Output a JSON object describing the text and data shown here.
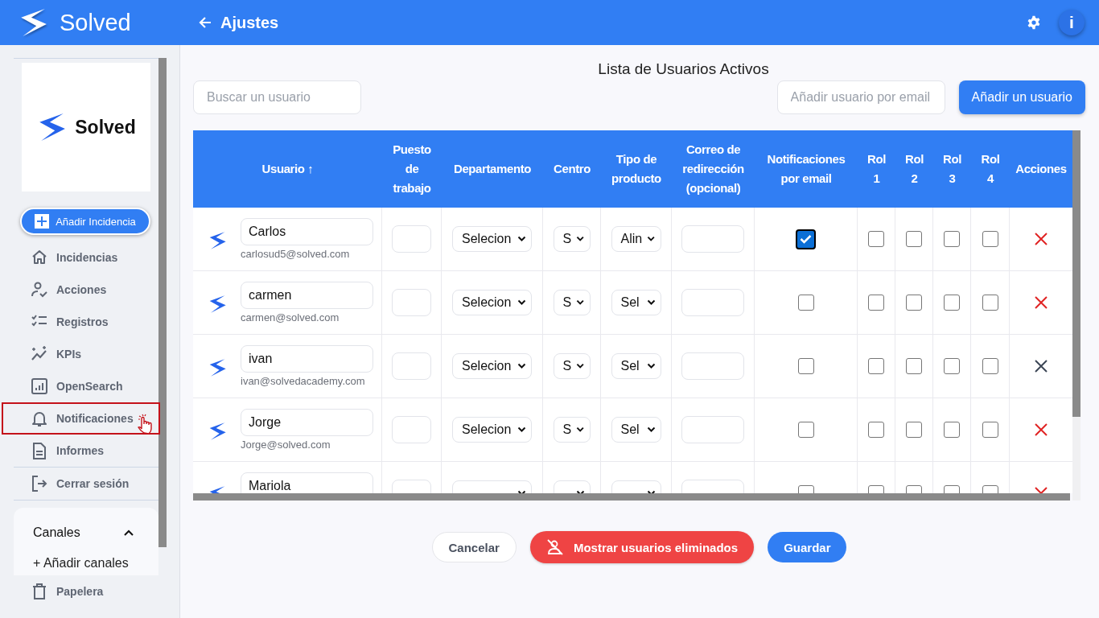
{
  "header": {
    "app_name": "Solved",
    "page_title": "Ajustes",
    "info_button": "i"
  },
  "sidebar": {
    "logo_text": "Solved",
    "add_button": "Añadir Incidencia",
    "items": [
      {
        "label": "Incidencias",
        "highlighted": false
      },
      {
        "label": "Acciones",
        "highlighted": false
      },
      {
        "label": "Registros",
        "highlighted": false
      },
      {
        "label": "KPIs",
        "highlighted": false
      },
      {
        "label": "OpenSearch",
        "highlighted": false
      },
      {
        "label": "Notificaciones",
        "highlighted": true
      },
      {
        "label": "Informes",
        "highlighted": false
      }
    ],
    "logout": "Cerrar sesión",
    "channels": {
      "title": "Canales",
      "expanded": true,
      "add_link": "+ Añadir canales"
    },
    "trash": "Papelera"
  },
  "main": {
    "title": "Lista de Usuarios Activos",
    "search": {
      "placeholder": "Buscar un usuario"
    },
    "email_field": {
      "placeholder": "Añadir usuario por email"
    },
    "add_button": "Añadir un usuario",
    "table": {
      "columns": [
        "Usuario ↑",
        "Puesto de trabajo",
        "Departamento",
        "Centro",
        "Tipo de producto",
        "Correo de redirección (opcional)",
        "Notificaciones por email",
        "Rol 1",
        "Rol 2",
        "Rol 3",
        "Rol 4",
        "Acciones"
      ],
      "rows": [
        {
          "name": "Carlos",
          "email": "carlosud5@solved.com",
          "department": "Selecion",
          "center": "S",
          "product": "Alin",
          "notify": true,
          "roles": [
            false,
            false,
            false,
            false
          ],
          "delete_hovered": false
        },
        {
          "name": "carmen",
          "email": "carmen@solved.com",
          "department": "Selecion",
          "center": "S",
          "product": "Sel",
          "notify": false,
          "roles": [
            false,
            false,
            false,
            false
          ],
          "delete_hovered": false
        },
        {
          "name": "ivan",
          "email": "ivan@solvedacademy.com",
          "department": "Selecion",
          "center": "S",
          "product": "Sel",
          "notify": false,
          "roles": [
            false,
            false,
            false,
            false
          ],
          "delete_hovered": true
        },
        {
          "name": "Jorge",
          "email": "Jorge@solved.com",
          "department": "Selecion",
          "center": "S",
          "product": "Sel",
          "notify": false,
          "roles": [
            false,
            false,
            false,
            false
          ],
          "delete_hovered": false
        },
        {
          "name": "Mariola",
          "notify": false,
          "roles": [
            false,
            false,
            false,
            false
          ],
          "delete_hovered": false
        }
      ]
    },
    "buttons": {
      "cancel": "Cancelar",
      "show_deleted": "Mostrar usuarios eliminados",
      "save": "Guardar"
    }
  }
}
